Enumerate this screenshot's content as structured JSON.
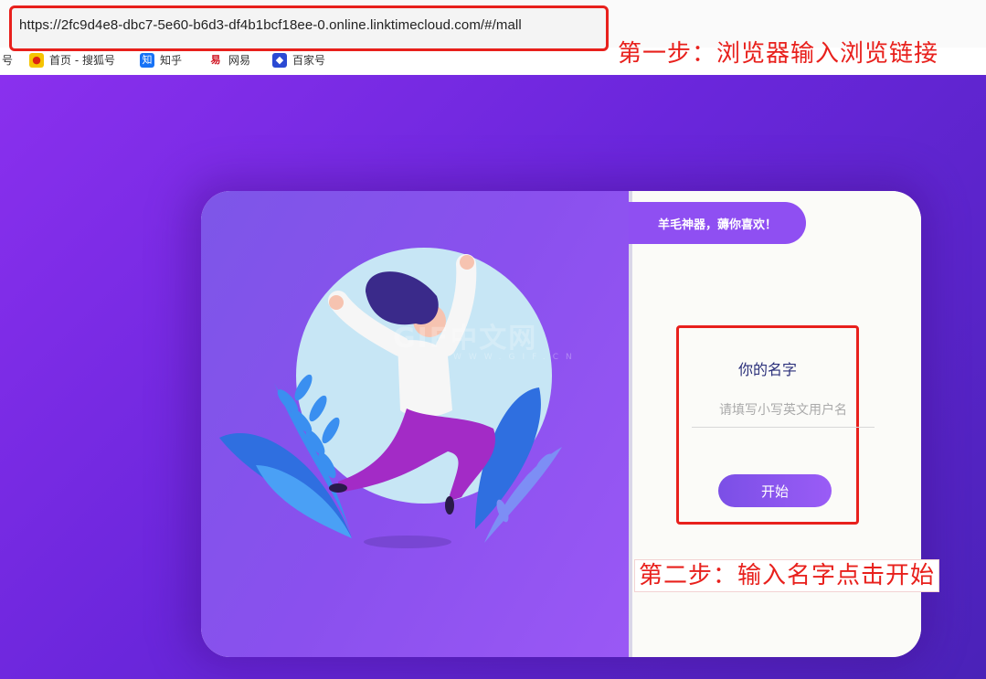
{
  "browser": {
    "url": "https://2fc9d4e8-dbc7-5e60-b6d3-df4b1bcf18ee-0.online.linktimecloud.com/#/mall",
    "bookmarks": [
      {
        "label": "号",
        "icon": "partial-icon"
      },
      {
        "label": "首页 - 搜狐号",
        "icon": "sohu-icon"
      },
      {
        "label": "知乎",
        "icon": "zhihu-icon"
      },
      {
        "label": "网易",
        "icon": "netease-icon"
      },
      {
        "label": "百家号",
        "icon": "baijiahao-icon"
      }
    ]
  },
  "annotations": {
    "step1": "第一步：浏览器输入浏览链接",
    "step2": "第二步：输入名字点击开始"
  },
  "app": {
    "slogan": "羊毛神器，薅你喜欢！",
    "name_title": "你的名字",
    "name_placeholder": "请填写小写英文用户名",
    "name_value": "",
    "start_label": "开始"
  },
  "watermark": {
    "text": "GIF中文网",
    "sub": "WWW.GIF.CN"
  },
  "colors": {
    "accent_red": "#e8201c",
    "brand_purple": "#8f4ff2"
  }
}
